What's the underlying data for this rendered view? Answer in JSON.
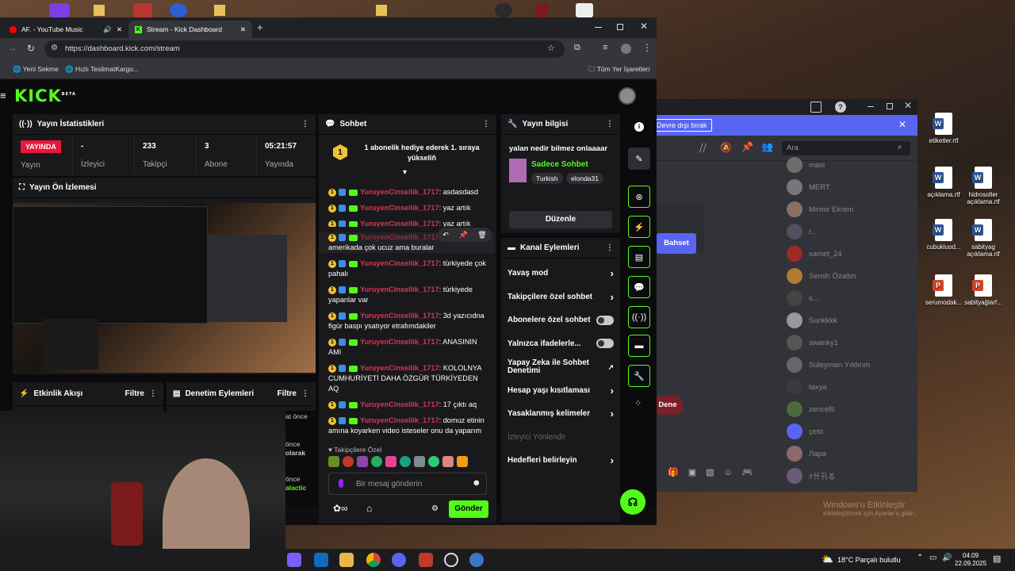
{
  "browser": {
    "tabs": [
      {
        "title": "AF. - YouTube Music",
        "active": false
      },
      {
        "title": "Stream - Kick Dashboard",
        "active": true
      }
    ],
    "url": "https://dashboard.kick.com/stream",
    "bookmarks": [
      "Yeni Sekme",
      "Hızlı TeslimatKargo..."
    ],
    "all_bookmarks": "Tüm Yer İşaretleri"
  },
  "kick": {
    "logo": "KICK",
    "logo_sup": "BETA",
    "stats": {
      "title": "Yayın İstatistikleri",
      "live_badge": "YAYINDA",
      "live_label": "Yayın",
      "viewers_value": "-",
      "viewers_label": "İzleyici",
      "followers_value": "233",
      "followers_label": "Takipçi",
      "subs_value": "3",
      "subs_label": "Abone",
      "uptime_value": "05:21:57",
      "uptime_label": "Yayında"
    },
    "preview_title": "Yayın Ön İzlemesi",
    "activity": {
      "title": "Etkinlik Akışı",
      "filter": "Filtre"
    },
    "moderation": {
      "title": "Denetim Eylemleri",
      "filter": "Filtre"
    },
    "chat": {
      "title": "Sohbet",
      "pinned_count": "1",
      "pinned_text": "1 abonelik hediye ederek 1. sıraya yükseliň",
      "messages": [
        {
          "user": "YuruyenCinsellik_1717",
          "text": ": asdasdasd"
        },
        {
          "user": "YuruyenCinsellik_1717",
          "text": ": yaz artık"
        },
        {
          "user": "YuruyenCinsellik_1717",
          "text": ": yaz artık"
        },
        {
          "user": "YuruyenCinsellik_1717",
          "text": ": hala amerikada çok ucuz ama buralar"
        },
        {
          "user": "YuruyenCinsellik_1717",
          "text": ": türkiyede çok pahalı"
        },
        {
          "user": "YuruyenCinsellik_1717",
          "text": ": türkiyede yapanlar var"
        },
        {
          "user": "YuruyenCinsellik_1717",
          "text": ": 3d yazıcıdna figür baspı ysatıyor etrafımdakiler"
        },
        {
          "user": "YuruyenCinsellik_1717",
          "text": ": ANASININ AMI"
        },
        {
          "user": "YuruyenCinsellik_1717",
          "text": ": KOLOLNYA CUMHURİYETİ DAHA ÖZGÜR TÜRKİYEDEN AQ"
        },
        {
          "user": "YuruyenCinsellik_1717",
          "text": ": 17 çıktı aq"
        },
        {
          "user": "YuruyenCinsellik_1717",
          "text": ": domuz etinin amına koyarken video isteseler onu da yaparım"
        }
      ],
      "followers_only_label": "Takipçilere Özel",
      "input_placeholder": "Bir mesaj gönderin",
      "send": "Gönder"
    },
    "stream_info": {
      "title": "Yayın bilgisi",
      "stream_title": "yalan nedir bilmez onlaaaar",
      "category": "Sadece Sohbet",
      "tags": [
        "Turkish",
        "elonda31"
      ],
      "edit": "Düzenle"
    },
    "channel_actions": {
      "title": "Kanal Eylemleri",
      "items": [
        {
          "label": "Yavaş mod",
          "control": "chevron"
        },
        {
          "label": "Takipçilere özel sohbet",
          "control": "chevron"
        },
        {
          "label": "Abonelere özel sohbet",
          "control": "toggle"
        },
        {
          "label": "Yalnızca ifadelerle...",
          "control": "toggle"
        },
        {
          "label": "Yapay Zeka ile Sohbet Denetimi",
          "control": "external"
        },
        {
          "label": "Hesap yaşı kısıtlaması",
          "control": "chevron"
        },
        {
          "label": "Yasaklanmış kelimeler",
          "control": "chevron"
        },
        {
          "label": "İzleyici Yönlendir",
          "control": "none"
        },
        {
          "label": "Hedefleri belirleyin",
          "control": "chevron"
        }
      ]
    },
    "webcam_overlay": [
      "at önce",
      "önce",
      "olarak",
      "önce",
      "alactic"
    ]
  },
  "discord": {
    "banner": "Devre dışı bırak",
    "search_placeholder": "Ara",
    "button": "Bahset",
    "dene": "Dene",
    "members": [
      "maxi",
      "MERT",
      "Mirmir Ekrem",
      "r...",
      "samet_24",
      "Semih Özaltın",
      "s...",
      "Sunkkkk",
      "swanky1",
      "Süleyman Yıldırım",
      "taxya",
      "zencefil",
      "çeto",
      "Лара",
      "ﾒ卄卂る"
    ],
    "watermark": "Windows'u Etkinleştir",
    "watermark2": "etkinleştirmek için Ayarlar'a gidin."
  },
  "desktop_icons": [
    {
      "label": "etiketler.rtf",
      "type": "word"
    },
    {
      "label": "açıklama.rtf",
      "type": "word"
    },
    {
      "label": "hidrosoller açıklama.rtf",
      "type": "word"
    },
    {
      "label": "cubukluod...",
      "type": "word"
    },
    {
      "label": "sabityag açıklama.rtf",
      "type": "word"
    },
    {
      "label": "serumodak...",
      "type": "ppt"
    },
    {
      "label": "sabityağlarf...",
      "type": "ppt"
    }
  ],
  "taskbar": {
    "weather": "18°C  Parçalı bulutlu",
    "time": "04:09",
    "date": "22.09.2025"
  }
}
